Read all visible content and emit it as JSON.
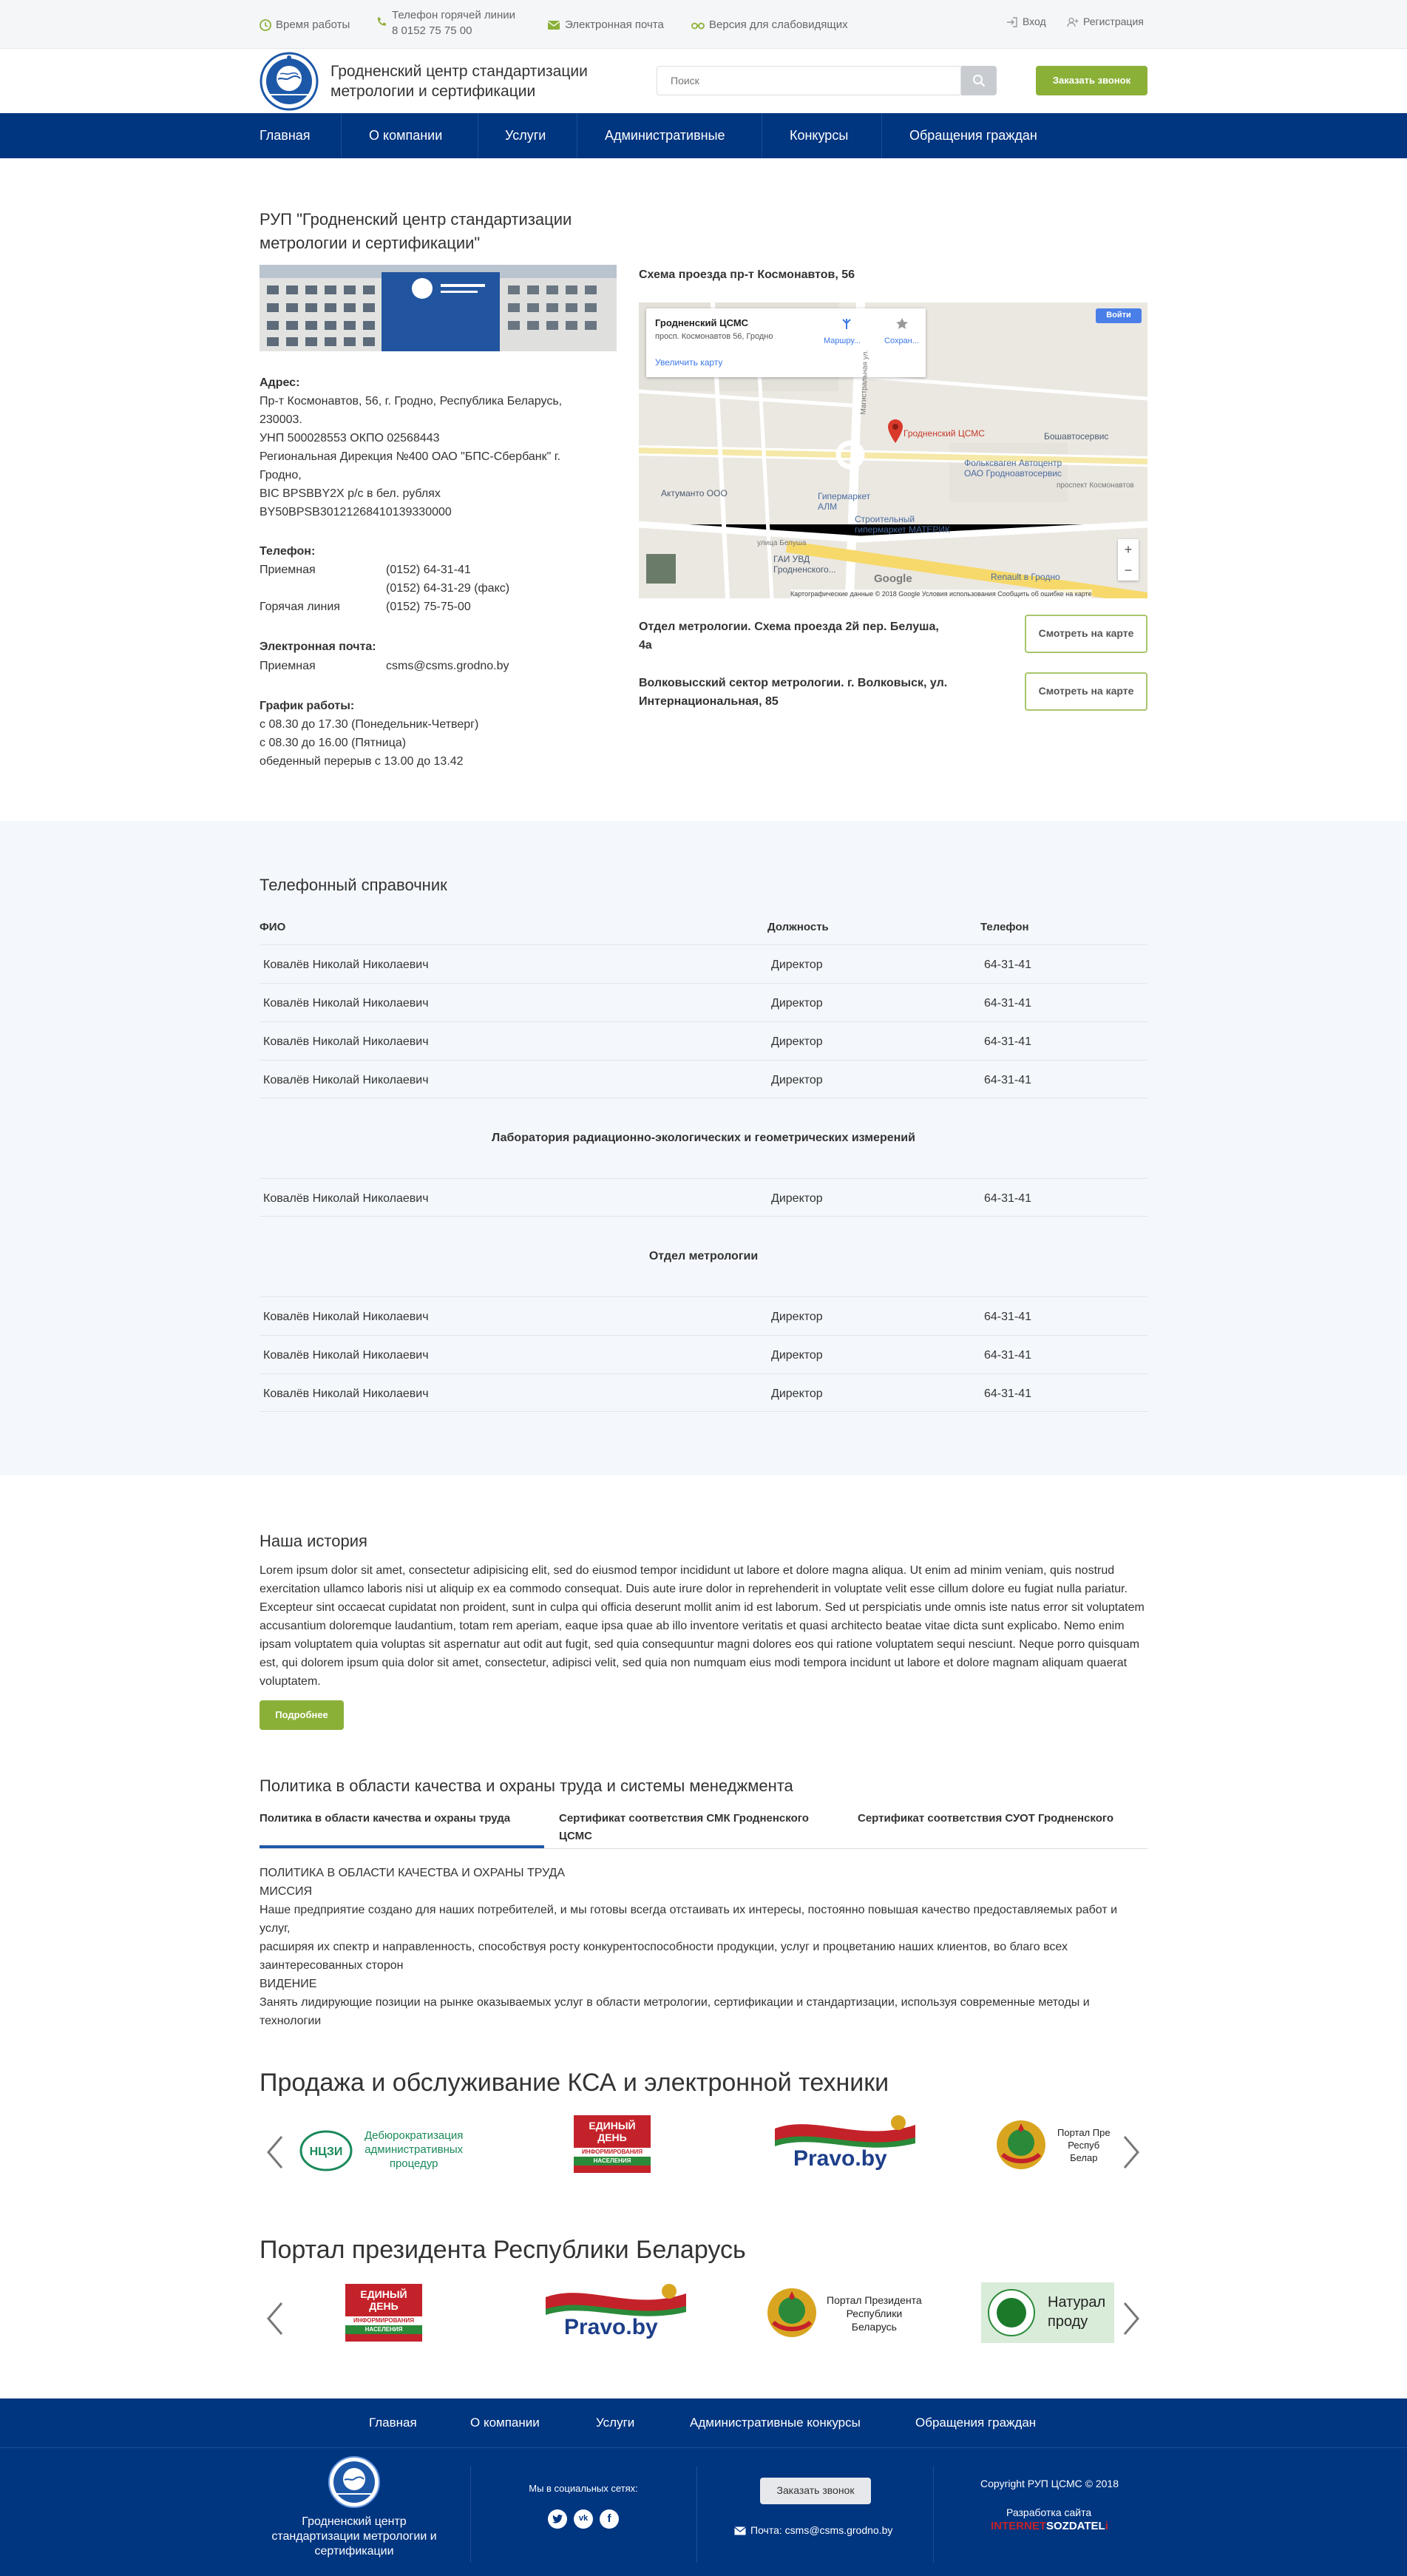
{
  "topbar": {
    "hours": "Время работы",
    "hotline_label": "Телефон горячей линии",
    "hotline_number": "8 0152 75 75 00",
    "email": "Электронная почта",
    "vision": "Версия для слабовидящих",
    "login": "Вход",
    "register": "Регистрация"
  },
  "header": {
    "brand_line1": "Гродненский центр стандартизации",
    "brand_line2": "метрологии и сертификации",
    "search_placeholder": "Поиск",
    "callback": "Заказать звонок"
  },
  "nav": [
    "Главная",
    "О компании",
    "Услуги",
    "Административные",
    "Конкурсы",
    "Обращения граждан"
  ],
  "contacts": {
    "title_line1": "РУП \"Гродненский центр стандартизации",
    "title_line2": "метрологии и сертификации\"",
    "address_label": "Адрес:",
    "address_lines": [
      "Пр-т Космонавтов, 56, г. Гродно, Республика Беларусь,",
      "230003.",
      "УНП 500028553 ОКПО 02568443",
      "Региональная Дирекция №400 ОАО \"БПС-Сбербанк\" г.",
      "Гродно,",
      "BIC BPSBBY2X р/с в бел. рублях",
      "BY50BPSB30121268410139330000"
    ],
    "phone_label": "Телефон:",
    "phones": [
      {
        "name": "Приемная",
        "value": "(0152) 64-31-41"
      },
      {
        "name": "",
        "value": "(0152) 64-31-29 (факс)"
      },
      {
        "name": "Горячая линия",
        "value": "(0152) 75-75-00"
      }
    ],
    "email_label": "Электронная почта:",
    "email_name": "Приемная",
    "email_value": "csms@csms.grodno.by",
    "schedule_label": "График работы:",
    "schedule_lines": [
      "с 08.30 до 17.30 (Понедельник-Четверг)",
      "с 08.30 до 16.00 (Пятница)",
      "обеденный перерыв с 13.00 до 13.42"
    ]
  },
  "map": {
    "title": "Схема проезда пр-т Космонавтов, 56",
    "card_title": "Гродненский ЦСМС",
    "card_addr": "просп. Космонавтов 56, Гродно",
    "card_route": "Маршру...",
    "card_save": "Сохран...",
    "card_enlarge": "Увеличить карту",
    "login": "Войти",
    "marker_label": "Гродненский ЦСМС",
    "labels": [
      "Бошавтосервис",
      "Фольксваген Автоцентр",
      "ОАО Гродноавтосервис",
      "Актуманто ООО",
      "Гипермаркет",
      "АЛМ",
      "Строительный",
      "гипермаркет МАТЕРИК",
      "ГАИ УВД",
      "Гродненского...",
      "Renault в Гродно",
      "проспект Космонавтов",
      "улица Белуша",
      "Магистральная ул."
    ],
    "google": "Google",
    "credits": "Картографические данные © 2018 Google   Условия использования   Сообщить об ошибке на карте",
    "zoom_in": "+",
    "zoom_out": "−"
  },
  "branches": [
    {
      "line1": "Отдел метрологии. Схема проезда 2й пер. Белуша,",
      "line2": "4а",
      "button": "Смотреть на карте"
    },
    {
      "line1": "Волковысский сектор метрологии. г. Волковыск, ул.",
      "line2": "Интернациональная, 85",
      "button": "Смотреть на карте"
    }
  ],
  "phonebook": {
    "title": "Телефонный справочник",
    "headers": [
      "ФИО",
      "Должность",
      "Телефон"
    ],
    "group1": [
      [
        "Ковалёв Николай Николаевич",
        "Директор",
        "64-31-41"
      ],
      [
        "Ковалёв Николай Николаевич",
        "Директор",
        "64-31-41"
      ],
      [
        "Ковалёв Николай Николаевич",
        "Директор",
        "64-31-41"
      ],
      [
        "Ковалёв Николай Николаевич",
        "Директор",
        "64-31-41"
      ]
    ],
    "section2": "Лаборатория радиационно-экологических и геометрических измерений",
    "group2": [
      [
        "Ковалёв Николай Николаевич",
        "Директор",
        "64-31-41"
      ]
    ],
    "section3": "Отдел метрологии",
    "group3": [
      [
        "Ковалёв Николай Николаевич",
        "Директор",
        "64-31-41"
      ],
      [
        "Ковалёв Николай Николаевич",
        "Директор",
        "64-31-41"
      ],
      [
        "Ковалёв Николай Николаевич",
        "Директор",
        "64-31-41"
      ]
    ]
  },
  "history": {
    "title": "Наша история",
    "lines": [
      "Lorem ipsum dolor sit amet, consectetur adipisicing elit, sed do eiusmod tempor incididunt ut labore et dolore magna aliqua. Ut enim ad minim veniam, quis nostrud",
      "exercitation ullamco laboris nisi ut aliquip ex ea commodo consequat. Duis aute irure dolor in reprehenderit in voluptate velit esse cillum dolore eu fugiat nulla pariatur.",
      "Excepteur sint occaecat cupidatat non proident, sunt in culpa qui officia deserunt mollit anim id est laborum. Sed ut perspiciatis unde omnis iste natus error sit voluptatem",
      "accusantium doloremque laudantium, totam rem aperiam, eaque ipsa quae ab illo inventore veritatis et quasi architecto beatae vitae dicta sunt explicabo. Nemo enim",
      "ipsam voluptatem quia voluptas sit aspernatur aut odit aut fugit, sed quia consequuntur magni dolores eos qui ratione voluptatem sequi nesciunt. Neque porro quisquam",
      "est, qui dolorem ipsum quia dolor sit amet, consectetur, adipisci velit, sed quia non numquam eius modi tempora incidunt ut labore et dolore magnam aliquam quaerat",
      "voluptatem."
    ],
    "more": "Подробнее"
  },
  "policy": {
    "title": "Политика в области качества и охраны труда и системы менеджмента",
    "tabs": [
      {
        "line1": "Политика в области качества и охраны труда",
        "line2": ""
      },
      {
        "line1": "Сертификат соответствия СМК Гродненского",
        "line2": "ЦСМС"
      },
      {
        "line1": "Сертификат соответствия СУОТ Гродненского",
        "line2": ""
      }
    ],
    "lines": [
      "ПОЛИТИКА В ОБЛАСТИ КАЧЕСТВА И ОХРАНЫ ТРУДА",
      "МИССИЯ",
      "Наше предприятие создано для наших потребителей, и мы готовы всегда отстаивать их интересы, постоянно повышая качество предоставляемых работ и услуг,",
      "расширяя их спектр и направленность, способствуя росту конкурентоспособности продукции, услуг и процветанию наших клиентов, во благо всех",
      "заинтересованных сторон",
      "ВИДЕНИЕ",
      "Занять лидирующие позиции на рынке оказываемых услуг в области метрологии, сертификации и стандартизации, используя современные методы и",
      "технологии"
    ]
  },
  "sales": {
    "title": "Продажа и обслуживание КСА и электронной техники",
    "debur_line1": "Дебюрократизация",
    "debur_line2": "административных",
    "debur_line3": "процедур",
    "edin_line1": "ЕДИНЫЙ",
    "edin_line2": "ДЕНЬ",
    "edin_line3": "ИНФОРМИРОВАНИЯ",
    "edin_line4": "НАСЕЛЕНИЯ",
    "pravo": "Pravo.by",
    "portal_line1": "Портал Пре",
    "portal_line2": "Респуб",
    "portal_line3": "Белар"
  },
  "portal": {
    "title": "Портал президента Республики Беларусь",
    "edin_line1": "ЕДИНЫЙ",
    "edin_line2": "ДЕНЬ",
    "edin_line3": "ИНФОРМИРОВАНИЯ",
    "edin_line4": "НАСЕЛЕНИЯ",
    "pravo": "Pravo.by",
    "portal_line1": "Портал Президента",
    "portal_line2": "Республики",
    "portal_line3": "Беларусь",
    "natural_line1": "Натурал",
    "natural_line2": "проду"
  },
  "footer": {
    "nav": [
      "Главная",
      "О компании",
      "Услуги",
      "Административные конкурсы",
      "Обращения граждан"
    ],
    "brand_line1": "Гродненский центр",
    "brand_line2": "стандартизации метрологии и",
    "brand_line3": "сертификации",
    "social_label": "Мы в социальных сетях:",
    "callback": "Заказать звонок",
    "email": "Почта: csms@csms.grodno.by",
    "copyright": "Copyright РУП ЦСМС © 2018",
    "dev_label": "Разработка сайта",
    "dev_brand_a": "INTERNET",
    "dev_brand_b": "SOZDATEL",
    "dev_brand_c": "i"
  },
  "colors": {
    "nav": "#003580",
    "accent": "#8bb038",
    "footer": "#003580"
  }
}
